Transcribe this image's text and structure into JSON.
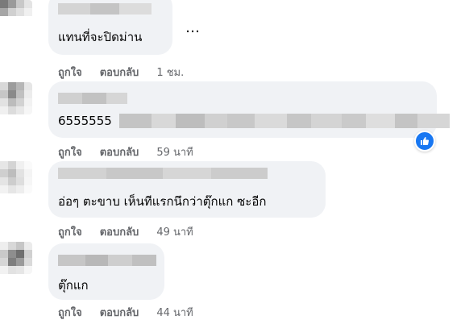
{
  "comments": [
    {
      "text": "แทนที่จะปิดม่าน",
      "more_label": "…",
      "like_label": "ถูกใจ",
      "reply_label": "ตอบกลับ",
      "time": "1 ชม."
    },
    {
      "text": "6555555",
      "like_label": "ถูกใจ",
      "reply_label": "ตอบกลับ",
      "time": "59 นาที",
      "reaction_icon": "like-icon"
    },
    {
      "text": "อ่อๆ ตะขาบ เห็นทีแรกนึกว่าตุ๊กแก ซะอีก",
      "like_label": "ถูกใจ",
      "reply_label": "ตอบกลับ",
      "time": "49 นาที"
    },
    {
      "text": "ตุ๊กแก",
      "like_label": "ถูกใจ",
      "reply_label": "ตอบกลับ",
      "time": "44 นาที"
    }
  ],
  "colors": {
    "bubble": "#f0f2f5",
    "meta_text": "#65676b",
    "reaction": "#1877f2"
  }
}
